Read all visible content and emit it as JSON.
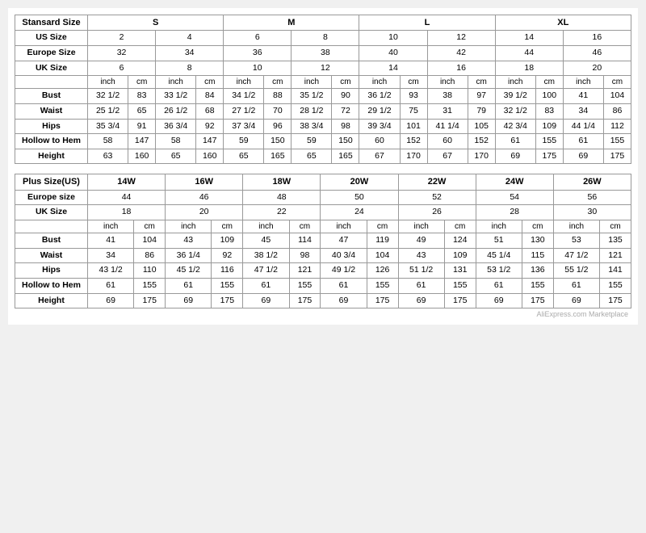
{
  "table1": {
    "title": "Stansard Size",
    "size_groups": [
      "S",
      "M",
      "L",
      "XL"
    ],
    "us_sizes": [
      "2",
      "4",
      "6",
      "8",
      "10",
      "12",
      "14",
      "16"
    ],
    "europe_sizes": [
      "32",
      "34",
      "36",
      "38",
      "40",
      "42",
      "44",
      "46"
    ],
    "uk_sizes": [
      "6",
      "8",
      "10",
      "12",
      "14",
      "16",
      "18",
      "20"
    ],
    "rows": [
      {
        "label": "Bust",
        "values": [
          "32 1/2",
          "83",
          "33 1/2",
          "84",
          "34 1/2",
          "88",
          "35 1/2",
          "90",
          "36 1/2",
          "93",
          "38",
          "97",
          "39 1/2",
          "100",
          "41",
          "104"
        ]
      },
      {
        "label": "Waist",
        "values": [
          "25 1/2",
          "65",
          "26 1/2",
          "68",
          "27 1/2",
          "70",
          "28 1/2",
          "72",
          "29 1/2",
          "75",
          "31",
          "79",
          "32 1/2",
          "83",
          "34",
          "86"
        ]
      },
      {
        "label": "Hips",
        "values": [
          "35 3/4",
          "91",
          "36 3/4",
          "92",
          "37 3/4",
          "96",
          "38 3/4",
          "98",
          "39 3/4",
          "101",
          "41 1/4",
          "105",
          "42 3/4",
          "109",
          "44 1/4",
          "112"
        ]
      },
      {
        "label": "Hollow to Hem",
        "values": [
          "58",
          "147",
          "58",
          "147",
          "59",
          "150",
          "59",
          "150",
          "60",
          "152",
          "60",
          "152",
          "61",
          "155",
          "61",
          "155"
        ]
      },
      {
        "label": "Height",
        "values": [
          "63",
          "160",
          "65",
          "160",
          "65",
          "165",
          "65",
          "165",
          "67",
          "170",
          "67",
          "170",
          "69",
          "175",
          "69",
          "175"
        ]
      }
    ]
  },
  "table2": {
    "title": "Plus Size(US)",
    "size_groups": [
      "14W",
      "16W",
      "18W",
      "20W",
      "22W",
      "24W",
      "26W"
    ],
    "europe_sizes": [
      "44",
      "46",
      "48",
      "50",
      "52",
      "54",
      "56"
    ],
    "uk_sizes": [
      "18",
      "20",
      "22",
      "24",
      "26",
      "28",
      "30"
    ],
    "rows": [
      {
        "label": "Bust",
        "values": [
          "41",
          "104",
          "43",
          "109",
          "45",
          "114",
          "47",
          "119",
          "49",
          "124",
          "51",
          "130",
          "53",
          "135"
        ]
      },
      {
        "label": "Waist",
        "values": [
          "34",
          "86",
          "36 1/4",
          "92",
          "38 1/2",
          "98",
          "40 3/4",
          "104",
          "43",
          "109",
          "45 1/4",
          "115",
          "47 1/2",
          "121"
        ]
      },
      {
        "label": "Hips",
        "values": [
          "43 1/2",
          "110",
          "45 1/2",
          "116",
          "47 1/2",
          "121",
          "49 1/2",
          "126",
          "51 1/2",
          "131",
          "53 1/2",
          "136",
          "55 1/2",
          "141"
        ]
      },
      {
        "label": "Hollow to Hem",
        "values": [
          "61",
          "155",
          "61",
          "155",
          "61",
          "155",
          "61",
          "155",
          "61",
          "155",
          "61",
          "155",
          "61",
          "155"
        ]
      },
      {
        "label": "Height",
        "values": [
          "69",
          "175",
          "69",
          "175",
          "69",
          "175",
          "69",
          "175",
          "69",
          "175",
          "69",
          "175",
          "69",
          "175"
        ]
      }
    ]
  },
  "labels": {
    "inch": "inch",
    "cm": "cm",
    "us_size": "US Size",
    "europe_size": "Europe Size",
    "uk_size": "UK Size",
    "europe_size2": "Europe size",
    "watermark": "AliExpress.com Marketplace"
  }
}
